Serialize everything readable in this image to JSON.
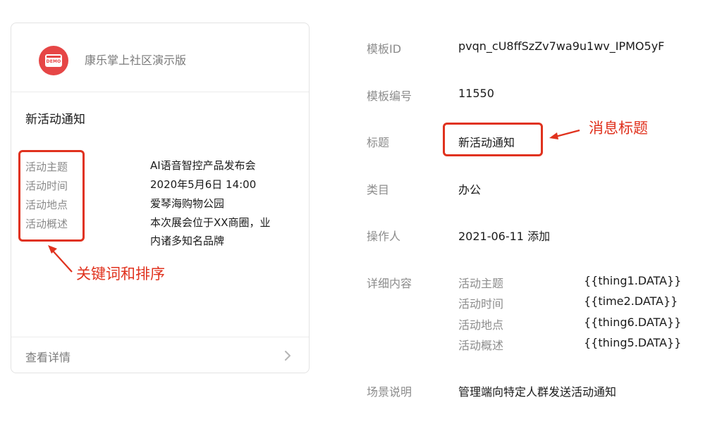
{
  "card": {
    "app_name": "康乐掌上社区演示版",
    "logo_text": "DEMO",
    "notice_title": "新活动通知",
    "rows": [
      {
        "label": "活动主题",
        "value": "AI语音智控产品发布会"
      },
      {
        "label": "活动时间",
        "value": "2020年5月6日 14:00"
      },
      {
        "label": "活动地点",
        "value": "爱琴海购物公园"
      },
      {
        "label": "活动概述",
        "value_line1": "本次展会位于XX商圈，业",
        "value_line2": "内诸多知名品牌"
      }
    ],
    "view_details": "查看详情"
  },
  "annotations": {
    "keywords_note": "关键词和排序",
    "title_note": "消息标题",
    "color": "#e0321e"
  },
  "details": {
    "template_id_label": "模板ID",
    "template_id_value": "pvqn_cU8ffSzZv7wa9u1wv_IPMO5yF",
    "template_no_label": "模板编号",
    "template_no_value": "11550",
    "title_label": "标题",
    "title_value": "新活动通知",
    "category_label": "类目",
    "category_value": "办公",
    "operator_label": "操作人",
    "operator_value": "2021-06-11 添加",
    "content_label": "详细内容",
    "content_rows": [
      {
        "key": "活动主题",
        "value": "{{thing1.DATA}}"
      },
      {
        "key": "活动时间",
        "value": "{{time2.DATA}}"
      },
      {
        "key": "活动地点",
        "value": "{{thing6.DATA}}"
      },
      {
        "key": "活动概述",
        "value": "{{thing5.DATA}}"
      }
    ],
    "scene_label": "场景说明",
    "scene_value": "管理端向特定人群发送活动通知"
  }
}
